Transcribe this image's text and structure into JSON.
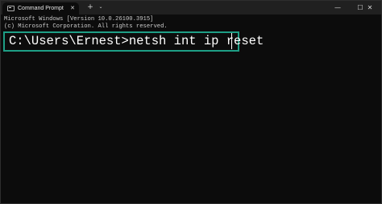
{
  "window": {
    "tab_title": "Command Prompt",
    "tab_icon": "terminal-icon",
    "tab_close_icon": "close-icon",
    "new_tab_icon": "plus-icon",
    "dropdown_icon": "chevron-down-icon",
    "minimize_icon": "minimize-icon",
    "maximize_icon": "maximize-icon",
    "close_icon": "close-icon"
  },
  "terminal": {
    "lines": [
      "Microsoft Windows [Version 10.0.26100.3915]",
      "(c) Microsoft Corporation. All rights reserved."
    ],
    "prompt": "C:\\Users\\Ernest>",
    "command": "netsh int ip reset",
    "highlight_color": "#1e9e85",
    "background": "#0c0c0c"
  }
}
